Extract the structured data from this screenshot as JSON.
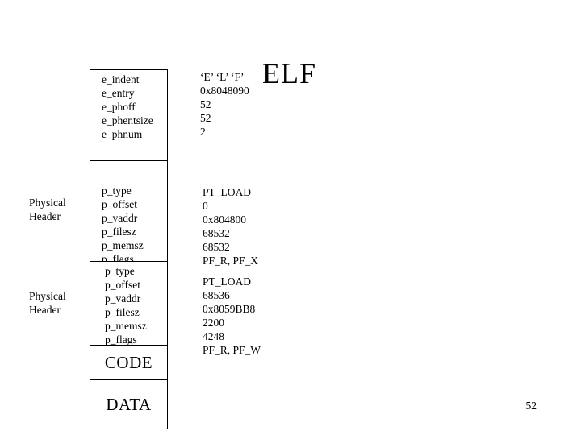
{
  "slide": {
    "title": "ELF",
    "page_number": "52"
  },
  "side_labels": [
    {
      "line1": "Physical",
      "line2": "Header"
    },
    {
      "line1": "Physical",
      "line2": "Header"
    }
  ],
  "structure": {
    "elf_header": {
      "fields": [
        "e_indent",
        "e_entry",
        "e_phoff",
        "e_phentsize",
        "e_phnum"
      ],
      "values": [
        "‘E’ ‘L’ ‘F’",
        "0x8048090",
        "52",
        "52",
        "2"
      ]
    },
    "spacer": {
      "label": ""
    },
    "program_header_1": {
      "fields": [
        "p_type",
        "p_offset",
        "p_vaddr",
        "p_filesz",
        "p_memsz",
        "p_flags"
      ],
      "values": [
        "PT_LOAD",
        "0",
        "0x804800",
        "68532",
        "68532",
        "PF_R, PF_X"
      ]
    },
    "program_header_2": {
      "fields": [
        "p_type",
        "p_offset",
        "p_vaddr",
        "p_filesz",
        "p_memsz",
        "p_flags"
      ],
      "values": [
        "PT_LOAD",
        "68536",
        "0x8059BB8",
        "2200",
        "4248",
        "PF_R, PF_W"
      ]
    },
    "segments": [
      {
        "label": "CODE"
      },
      {
        "label": "DATA"
      }
    ]
  },
  "colors": {
    "background": "#ffffff",
    "foreground": "#000000",
    "border": "#000000"
  }
}
